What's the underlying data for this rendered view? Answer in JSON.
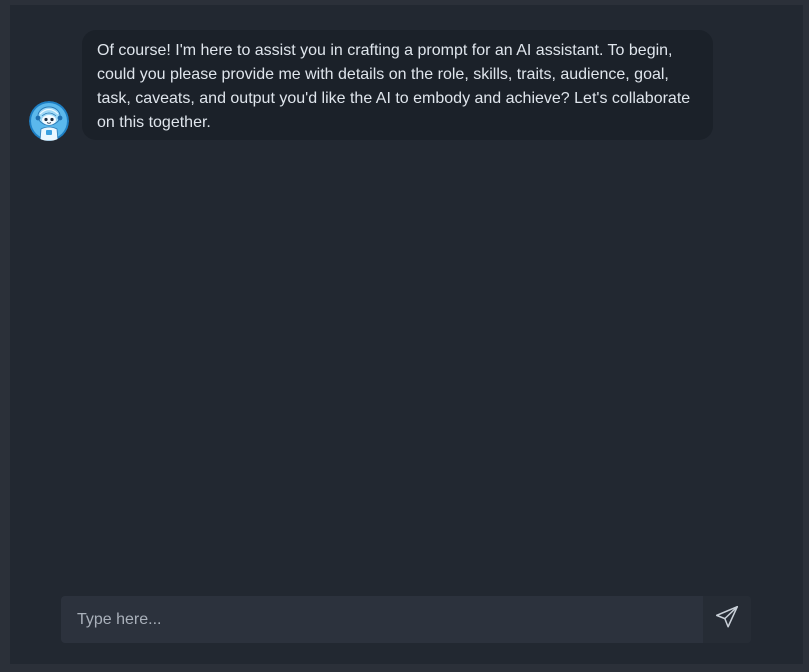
{
  "conversation": {
    "messages": [
      {
        "sender": "assistant",
        "avatar_icon": "robot-avatar-icon",
        "text": "Of course! I'm here to assist you in crafting a prompt for an AI assistant. To begin, could you please provide me with details on the role, skills, traits, audience, goal, task, caveats, and output you'd like the AI to embody and achieve? Let's collaborate on this together."
      }
    ]
  },
  "composer": {
    "placeholder": "Type here...",
    "value": "",
    "send_icon": "send-icon"
  },
  "colors": {
    "page_background": "#2b3039",
    "chat_background": "#222831",
    "bubble_background": "#1b2129",
    "input_background": "#2c323d",
    "text": "#dfe5ec",
    "avatar_accent": "#3aa0e0"
  }
}
